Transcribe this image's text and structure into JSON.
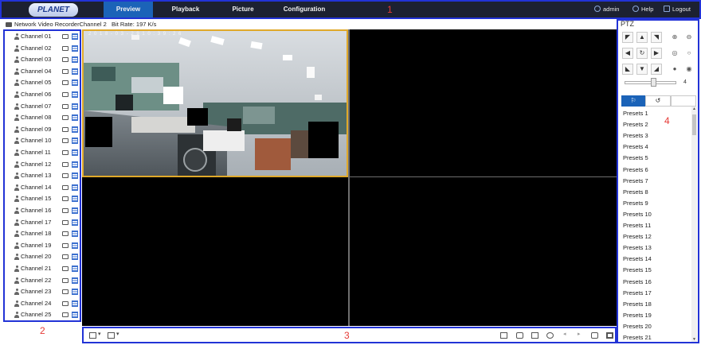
{
  "app": {
    "logo_text": "PLANET",
    "colors": {
      "topbar_bg": "#1c2131",
      "active_tab": "#1b63b8",
      "annotation_border": "#2233d6",
      "callout_number": "#e53935",
      "selected_tile": "#e0a92a"
    }
  },
  "nav": {
    "tabs": [
      "Preview",
      "Playback",
      "Picture",
      "Configuration"
    ],
    "active": "Preview"
  },
  "header_right": {
    "user": "admin",
    "help": "Help",
    "logout": "Logout",
    "icons": [
      "user-icon",
      "help-icon",
      "logout-icon"
    ]
  },
  "info_bar": {
    "device": "Network Video Recorder",
    "channel": "Channel 2",
    "bitrate": "Bit Rate: 197 K/s"
  },
  "channels": [
    "Channel 01",
    "Channel 02",
    "Channel 03",
    "Channel 04",
    "Channel 05",
    "Channel 06",
    "Channel 07",
    "Channel 08",
    "Channel 09",
    "Channel 10",
    "Channel 11",
    "Channel 12",
    "Channel 13",
    "Channel 14",
    "Channel 15",
    "Channel 16",
    "Channel 17",
    "Channel 18",
    "Channel 19",
    "Channel 20",
    "Channel 21",
    "Channel 22",
    "Channel 23",
    "Channel 24",
    "Channel 25"
  ],
  "ptz": {
    "title": "PTZ",
    "direction_icons": [
      "up-left",
      "up",
      "up-right",
      "left",
      "auto-rotate",
      "right",
      "down-left",
      "down",
      "down-right"
    ],
    "zoom_icons": [
      "zoom-in",
      "zoom-out",
      "focus-near",
      "focus-far",
      "iris-open",
      "iris-close"
    ],
    "speed": "4",
    "speed_fraction": 0.55,
    "tabs": [
      "preset-tab",
      "patrol-tab"
    ],
    "active_tab": "preset-tab",
    "presets": [
      "Presets 1",
      "Presets 2",
      "Presets 3",
      "Presets 4",
      "Presets 5",
      "Presets 6",
      "Presets 7",
      "Presets 8",
      "Presets 9",
      "Presets 10",
      "Presets 11",
      "Presets 12",
      "Presets 13",
      "Presets 14",
      "Presets 15",
      "Presets 16",
      "Presets 17",
      "Presets 18",
      "Presets 19",
      "Presets 20",
      "Presets 21"
    ]
  },
  "video": {
    "layout": "2x2",
    "selected_tile": 1,
    "overlay_text": "2 0 1 8 - 0 3 - 2 9   1 0 : 3 9 : 2 6"
  },
  "toolbar": {
    "left_icons": [
      "layout-icon",
      "stream-icon"
    ],
    "right_icons": [
      "stop-all-icon",
      "capture-icon",
      "record-icon",
      "zoom-icon",
      "prev-page-icon",
      "next-page-icon",
      "volume-icon",
      "fullscreen-icon"
    ]
  },
  "callouts": [
    "1",
    "2",
    "3",
    "4"
  ]
}
